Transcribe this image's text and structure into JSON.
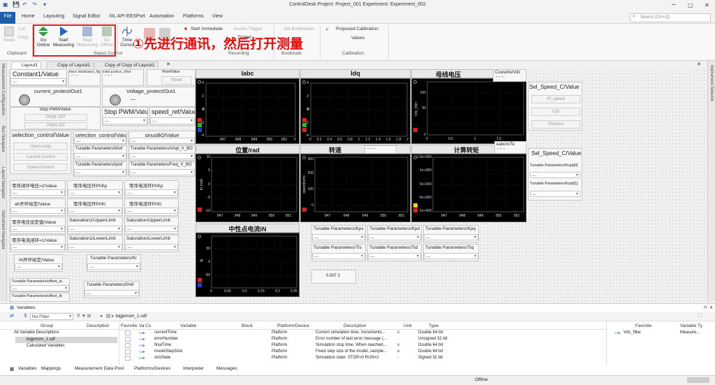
{
  "app": {
    "title": "ControlDesk  Project: Project_001  Experiment: Experiment_002",
    "win_min": "–",
    "win_max": "▢",
    "win_close": "✕"
  },
  "menu": {
    "file": "File",
    "items": [
      "Home",
      "Layouting",
      "Signal Editor",
      "XIL API EESPort",
      "Automation",
      "Platforms",
      "View"
    ],
    "search_placeholder": "Search (Ctrl+Q)"
  },
  "ribbon": {
    "paste": "Paste",
    "cut": "Cut",
    "copy": "Copy",
    "clipboard": "Clipboard",
    "go_online": [
      "Go",
      "Online"
    ],
    "start_measuring": [
      "Start",
      "Measuring"
    ],
    "stop_measuring": [
      "Stop",
      "Measuring"
    ],
    "go_offline": [
      "Go",
      "Offline"
    ],
    "status_control": "Status Control",
    "time_cursor": [
      "Time",
      "Cursor"
    ],
    "start_immediate": "Start Immediate",
    "invoke_trigger": "Invoke Trigger",
    "trigger": "Trigger",
    "recording": "Recording",
    "set_bookmarks": "Set Bookmarks",
    "bookmark": "Bookmark",
    "proposed_calibration": "Proposed Calibration",
    "values": "Values",
    "calibration": "Calibration",
    "annotation": "①先进行通讯，然后打开测量"
  },
  "tabs": [
    "Layout1",
    "Copy of Layout1",
    "Copy of Copy of Layout1"
  ],
  "side": {
    "left": [
      "Measurement Configuration",
      "Bus Navigator",
      "Layout Navigator",
      "Instrument Navigator"
    ],
    "right": "Instrument Selector"
  },
  "controls": {
    "constant1": "Constant1/Value",
    "motor_init": "Motor initialization_flag",
    "init_pos": "Initial position_offset",
    "reset_value": "ResetValue",
    "reset_btn": "Reset",
    "current_protect": "current_protect/Out1",
    "voltage_protect": "Voltage_protect/Out1",
    "voltage_dash": "—",
    "stop_pwm1": "Stop PWM/Value",
    "pwm_off": "PWM OFF",
    "pwm_on": "PWM ON",
    "stop_pwm2": "Stop PWM/Value",
    "speed_ref": "speed_ref/Value",
    "selection1": "selection_control/Value",
    "open_loop": "Open-Loop",
    "current_control": "Current-Control",
    "speed_control": "Speed-Control",
    "selection2": "selection_control/Value",
    "sinus": "sinusBO/Value",
    "idref": "Tunable Parameters/idref",
    "ampl": "Tunable Parameters/Ampl_V_BO",
    "iqref": "Tunable Parameters/iqref",
    "freq": "Tunable Parameters/Freq_V_BO",
    "zero_loop2": "零序闭环电压=2/Value",
    "zero_volt_kp": "零序电压环PI/Kp",
    "zero_curr_kp": "零序电流环PI/Kp",
    "ah_open": "ah开环给定/Value",
    "zero_volt_ki": "零序电压环PI/Ki",
    "zero_curr_ki": "零序电流环PI/Ki",
    "zero_volt_given": "零序电压设定值/Value",
    "sat1_upper": "Saturation1/UpperLimit",
    "sat_upper": "Saturation/UpperLimit",
    "zero_curr_loop1": "零序电流闭环=1/Value",
    "sat1_lower": "Saturation1/LowerLimit",
    "sat_lower": "Saturation/LowerLimit",
    "in_open": "iN开环给定/Value",
    "tp_kr": "Tunable Parameters/Kr",
    "tp_offset_ia": "Tunable Parameters/offset_ia",
    "tp_i0ref": "Tunable Parameters/i0ref",
    "tp_offset_ib": "Tunable Parameters/offset_ib",
    "courants_vdc": "Courants/Vdc",
    "eabc": "eabcIn/Te",
    "sel_speed1": "Sel_Speed_C/Value",
    "pi_speed": "PI_speed",
    "lqi": "LQI",
    "flatness": "Flatness",
    "sel_speed2": "Sel_Speed_C/Value",
    "kopt0": "Tunable Parameters/Kopt[0]",
    "kopt1": "Tunable Parameters/Kopt[1]",
    "kps": "Tunable Parameters/Kps",
    "kpd": "Tunable Parameters/Kpd",
    "kpq": "Tunable Parameters/Kpq",
    "tis": "Tunable Parameters/Tis",
    "tid": "Tunable Parameters/Tid",
    "tiq": "Tunable Parameters/Tiq",
    "value_display": "0.007  1",
    "dash": "---",
    "dash_dash": "- - -"
  },
  "plots": {
    "iabc": {
      "title": "Iabc",
      "yticks": [
        "4",
        "2",
        "0",
        "-2",
        "-4"
      ],
      "xticks": [
        "847",
        "848",
        "849",
        "850",
        "851",
        "0"
      ],
      "ylabel": "ia"
    },
    "idq": {
      "title": "Idq",
      "yticks": [
        "4",
        "2",
        "0",
        "-2",
        "-4"
      ],
      "xticks": [
        "0",
        "0.2",
        "0.4",
        "0.6",
        "0.8",
        "1",
        "1.2",
        "1.4",
        "1.6",
        "1.8",
        "2"
      ],
      "ylabel": "id"
    },
    "vdc": {
      "title": "母线电压",
      "yticks": [
        "100",
        "50",
        "0"
      ],
      "xticks": [
        "0",
        "0.5",
        "1",
        "1.5"
      ],
      "ylabel": "Vdc_filter"
    },
    "pos": {
      "title": "位置/rad",
      "yticks": [
        "10",
        "5",
        "0",
        "-5",
        "-10"
      ],
      "xticks": [
        "847",
        "848",
        "849",
        "850",
        "851"
      ],
      "ylabel": "th (rad)"
    },
    "speed": {
      "title": "转速",
      "yticks": [
        "300",
        "200",
        "100",
        "0"
      ],
      "xticks": [
        "847",
        "848",
        "849",
        "850",
        "851"
      ],
      "ylabel": "speed(rpm)"
    },
    "torque": {
      "title": "计算转矩",
      "yticks": [
        "1.5e+300",
        "1e+300",
        "5e+300",
        "-5e+300",
        "-1e+300"
      ],
      "xticks": [
        "847",
        "848",
        "849",
        "850",
        "851"
      ],
      "ylabel": ""
    },
    "neutral": {
      "title": "中性点电流iN",
      "yticks": [
        "50",
        "0",
        "-50"
      ],
      "xticks": [
        "0",
        "0.05",
        "0.1",
        "0.15",
        "0.2",
        "0.25"
      ],
      "ylabel": "iN"
    }
  },
  "variables": {
    "title": "Variables",
    "filter": "No Filter",
    "path": "bigpmsm_1.sdf",
    "left_headers": [
      "Group",
      "Description"
    ],
    "groups": [
      "All Variable Descriptions",
      "bigpmsm_1.sdf",
      "Calculated Variables"
    ],
    "headers": [
      "Favorite",
      "Va",
      "Co",
      "Variable",
      "Block",
      "Platform/Device",
      "Description",
      "Unit",
      "Type"
    ],
    "rows": [
      [
        "currentTime",
        "",
        "Platform",
        "Current simulation time. Increments...",
        "s",
        "Double 64 bit"
      ],
      [
        "errorNumber",
        "",
        "Platform",
        "Error number of last error message (...",
        "",
        "Unsigned 32 bit"
      ],
      [
        "finalTime",
        "",
        "Platform",
        "Simulation stop time. When reached,...",
        "s",
        "Double 64 bit"
      ],
      [
        "modelStepSize",
        "",
        "Platform",
        "Fixed step size of the model, sample...",
        "s",
        "Double 64 bit"
      ],
      [
        "simState",
        "",
        "Platform",
        "Simulation state: STOP=0 RUN=2",
        "-",
        "Signed 32 bit"
      ]
    ],
    "fav_headers": [
      "Favorite",
      "Variable Ty"
    ],
    "fav_rows": [
      [
        "Vdc_filter",
        "Measure..."
      ]
    ]
  },
  "bottom_tabs": [
    "Variables",
    "Mappings",
    "Measurement Data Pool",
    "Platforms/Devices",
    "Interpreter",
    "Messages"
  ],
  "status": "Offline"
}
